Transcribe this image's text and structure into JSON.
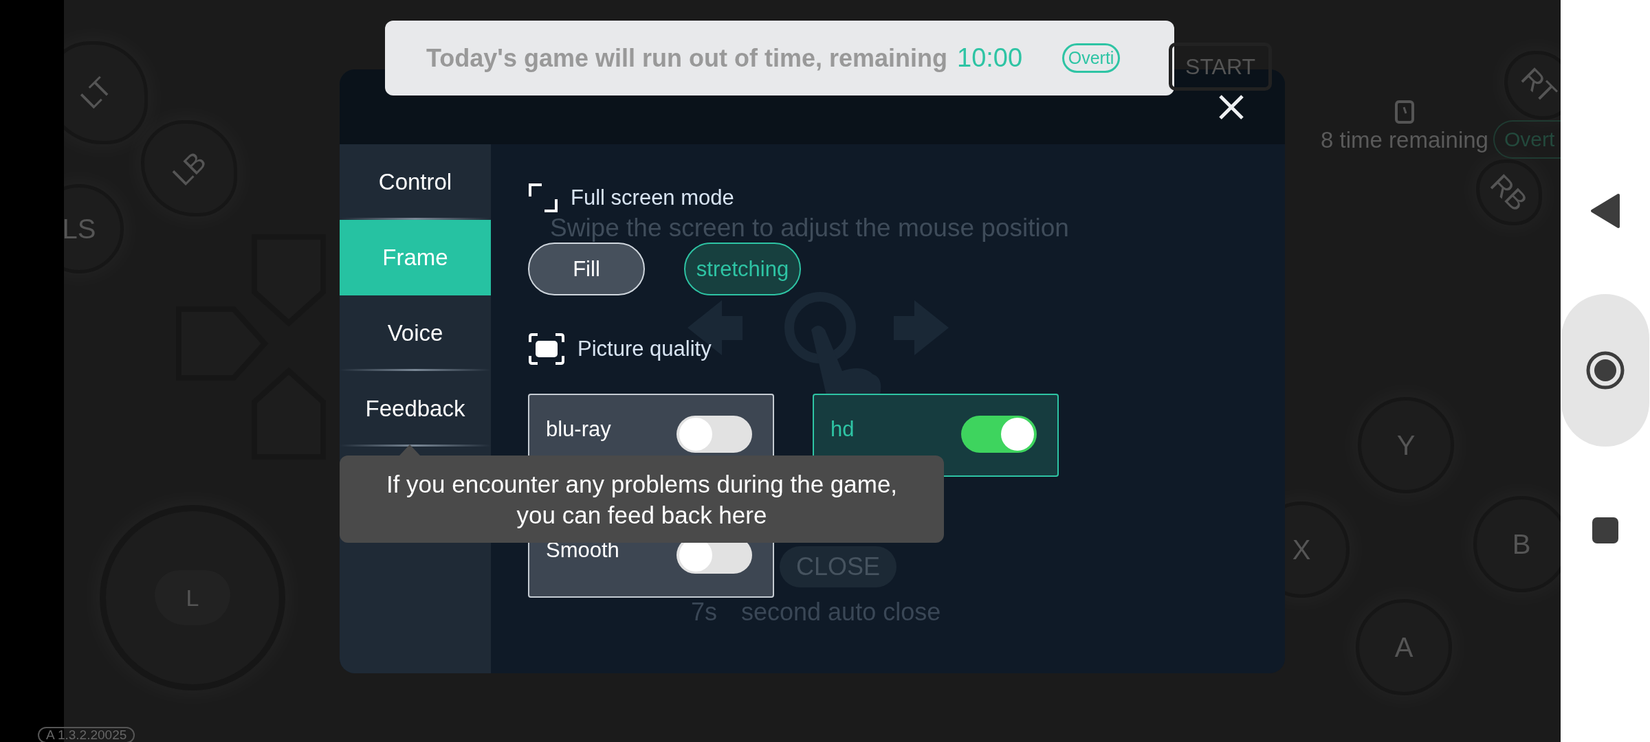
{
  "game_controls": [
    {
      "label": "LT",
      "kind": "trigger"
    },
    {
      "label": "LB",
      "kind": "trigger"
    },
    {
      "label": "LS",
      "kind": "stick"
    },
    {
      "label": "L",
      "kind": "joystick"
    },
    {
      "label": "RB",
      "kind": "trigger"
    },
    {
      "label": "RT",
      "kind": "trigger"
    },
    {
      "label": "Y",
      "kind": "face"
    },
    {
      "label": "X",
      "kind": "face"
    },
    {
      "label": "B",
      "kind": "face"
    },
    {
      "label": "A",
      "kind": "face"
    }
  ],
  "start_button": "START",
  "time_status": {
    "text": "8 time remaining",
    "badge": "Overt"
  },
  "version": "A 1.3.2.20025",
  "banner": {
    "message": "Today's game will run out of time, remaining",
    "time": "10:00",
    "button": "Overti"
  },
  "dialog": {
    "tabs": [
      {
        "label": "Control",
        "selected": false
      },
      {
        "label": "Frame",
        "selected": true
      },
      {
        "label": "Voice",
        "selected": false
      },
      {
        "label": "Feedback",
        "selected": false
      }
    ],
    "sections": [
      {
        "kind": "modes",
        "title": "Full screen mode",
        "options": [
          {
            "label": "Fill",
            "selected": false
          },
          {
            "label": "stretching",
            "selected": true
          }
        ]
      },
      {
        "kind": "toggles",
        "title": "Picture quality",
        "options": [
          {
            "label": "blu-ray",
            "on": false
          },
          {
            "label": "hd",
            "on": true
          },
          {
            "label": "Smooth",
            "on": false
          }
        ]
      }
    ]
  },
  "swipe_hint": {
    "text": "Swipe the screen to adjust the mouse position",
    "button": "CLOSE",
    "countdown": "7s",
    "countdown_text": "second auto close"
  },
  "tooltip": "If you encounter any problems during the game,\nyou can feed back here"
}
